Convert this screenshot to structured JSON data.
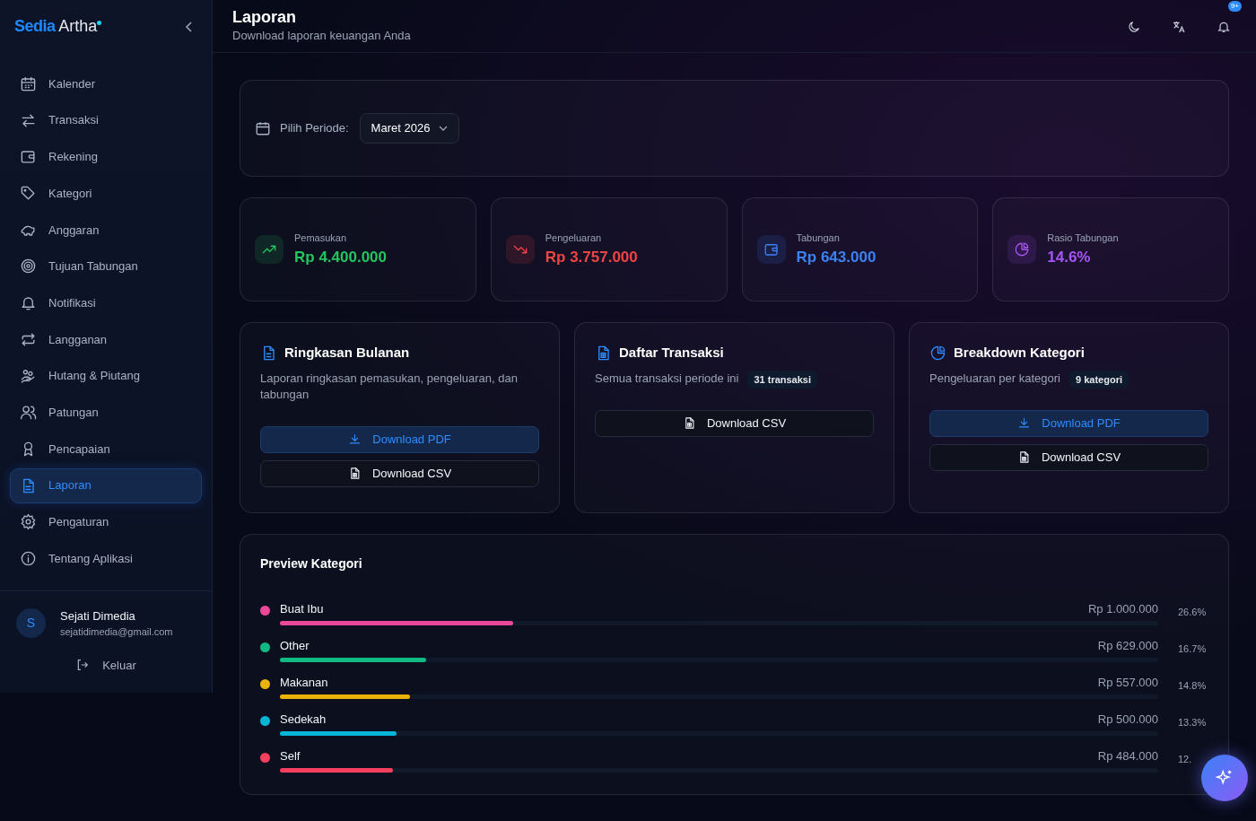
{
  "sidebar": {
    "brand": {
      "first": "Sedia",
      "second": "Artha"
    },
    "items": [
      {
        "label": "Kalender",
        "selected": false
      },
      {
        "label": "Transaksi",
        "selected": false
      },
      {
        "label": "Rekening",
        "selected": false
      },
      {
        "label": "Kategori",
        "selected": false
      },
      {
        "label": "Anggaran",
        "selected": false
      },
      {
        "label": "Tujuan Tabungan",
        "selected": false
      },
      {
        "label": "Notifikasi",
        "selected": false
      },
      {
        "label": "Langganan",
        "selected": false
      },
      {
        "label": "Hutang & Piutang",
        "selected": false
      },
      {
        "label": "Patungan",
        "selected": false
      },
      {
        "label": "Pencapaian",
        "selected": false
      },
      {
        "label": "Laporan",
        "selected": true
      },
      {
        "label": "Pengaturan",
        "selected": false
      },
      {
        "label": "Tentang Aplikasi",
        "selected": false
      }
    ],
    "user": {
      "initial": "S",
      "name": "Sejati Dimedia",
      "email": "sejatidimedia@gmail.com"
    },
    "logout": "Keluar"
  },
  "header": {
    "title": "Laporan",
    "subtitle": "Download laporan keuangan Anda",
    "notification_badge": "9+"
  },
  "period": {
    "label": "Pilih Periode:",
    "value": "Maret 2026"
  },
  "stats": [
    {
      "label": "Pemasukan",
      "value": "Rp 4.400.000",
      "color": "#22c55e"
    },
    {
      "label": "Pengeluaran",
      "value": "Rp 3.757.000",
      "color": "#ef4444"
    },
    {
      "label": "Tabungan",
      "value": "Rp 643.000",
      "color": "#3b82f6"
    },
    {
      "label": "Rasio Tabungan",
      "value": "14.6%",
      "color": "#a855f7"
    }
  ],
  "reports": [
    {
      "title": "Ringkasan Bulanan",
      "description": "Laporan ringkasan pemasukan, pengeluaran, dan tabungan",
      "buttons": [
        {
          "kind": "pdf",
          "label": "Download PDF"
        },
        {
          "kind": "csv",
          "label": "Download CSV"
        }
      ]
    },
    {
      "title": "Daftar Transaksi",
      "description": "Semua transaksi periode ini",
      "count": "31 transaksi",
      "buttons": [
        {
          "kind": "csv",
          "label": "Download CSV"
        }
      ]
    },
    {
      "title": "Breakdown Kategori",
      "description": "Pengeluaran per kategori",
      "count": "9 kategori",
      "buttons": [
        {
          "kind": "pdf",
          "label": "Download PDF"
        },
        {
          "kind": "csv",
          "label": "Download CSV"
        }
      ]
    }
  ],
  "preview": {
    "title": "Preview Kategori",
    "rows": [
      {
        "name": "Buat Ibu",
        "amount": "Rp 1.000.000",
        "percent": "26.6%",
        "level": 0.266,
        "color": "#ec4899"
      },
      {
        "name": "Other",
        "amount": "Rp 629.000",
        "percent": "16.7%",
        "level": 0.167,
        "color": "#10b981"
      },
      {
        "name": "Makanan",
        "amount": "Rp 557.000",
        "percent": "14.8%",
        "level": 0.148,
        "color": "#eab308"
      },
      {
        "name": "Sedekah",
        "amount": "Rp 500.000",
        "percent": "13.3%",
        "level": 0.133,
        "color": "#06b6d4"
      },
      {
        "name": "Self",
        "amount": "Rp 484.000",
        "percent": "12.",
        "level": 0.129,
        "color": "#f43f5e"
      }
    ]
  }
}
